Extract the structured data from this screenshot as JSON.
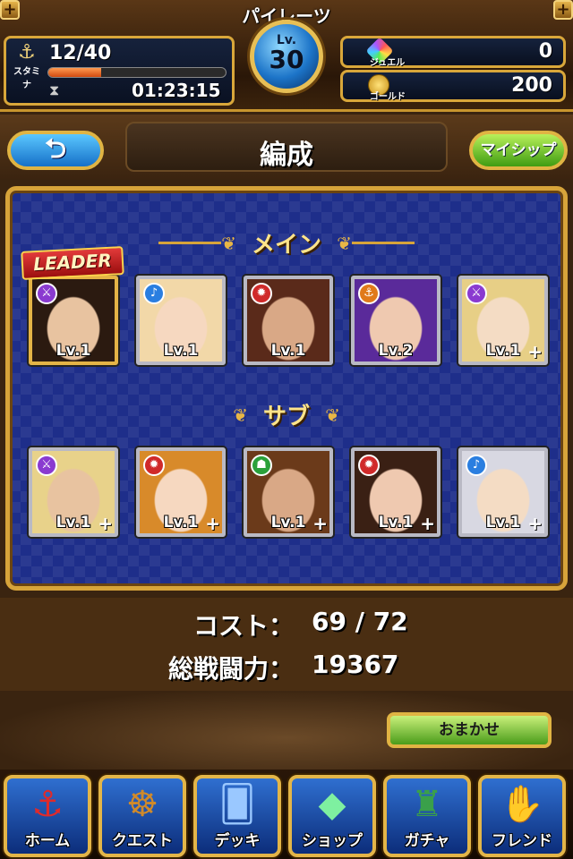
{
  "header": {
    "title": "パイレーツ",
    "stamina": {
      "label": "スタミナ",
      "value": "12/40",
      "fraction": 0.3,
      "timer": "01:23:15"
    },
    "level": {
      "prefix": "Lv.",
      "value": "30"
    },
    "jewel": {
      "label": "ジュエル",
      "value": "0"
    },
    "gold": {
      "label": "ゴールド",
      "value": "200"
    }
  },
  "titlebar": {
    "title": "編成",
    "back_label": "⮌",
    "myship_label": "マイシップ"
  },
  "main": {
    "section_main": "メイン",
    "section_sub": "サブ",
    "leader_label": "LEADER",
    "main_cards": [
      {
        "lv": "Lv.1",
        "attr": "sword",
        "attr_color": "#8a3ad0",
        "plus": ""
      },
      {
        "lv": "Lv.1",
        "attr": "note",
        "attr_color": "#2a7ee0",
        "plus": ""
      },
      {
        "lv": "Lv.1",
        "attr": "cannon",
        "attr_color": "#d02a2a",
        "plus": ""
      },
      {
        "lv": "Lv.2",
        "attr": "anchor",
        "attr_color": "#e07a1a",
        "plus": ""
      },
      {
        "lv": "Lv.1",
        "attr": "sword",
        "attr_color": "#8a3ad0",
        "plus": "+"
      }
    ],
    "sub_cards": [
      {
        "lv": "Lv.1",
        "attr": "sword",
        "attr_color": "#8a3ad0",
        "plus": "+"
      },
      {
        "lv": "Lv.1",
        "attr": "cannon",
        "attr_color": "#d02a2a",
        "plus": "+"
      },
      {
        "lv": "Lv.1",
        "attr": "hat",
        "attr_color": "#2aa03a",
        "plus": "+"
      },
      {
        "lv": "Lv.1",
        "attr": "cannon",
        "attr_color": "#d02a2a",
        "plus": "+"
      },
      {
        "lv": "Lv.1",
        "attr": "note",
        "attr_color": "#2a7ee0",
        "plus": "+"
      }
    ]
  },
  "stats": {
    "cost_label": "コスト：",
    "cost_value": "69 / 72",
    "power_label": "総戦闘力：",
    "power_value": "19367"
  },
  "omakase_label": "おまかせ",
  "nav": [
    {
      "label": "ホーム",
      "icon": "anchor-icon"
    },
    {
      "label": "クエスト",
      "icon": "ship-wheel-icon"
    },
    {
      "label": "デッキ",
      "icon": "cards-icon"
    },
    {
      "label": "ショップ",
      "icon": "gem-icon"
    },
    {
      "label": "ガチャ",
      "icon": "gacha-machine-icon"
    },
    {
      "label": "フレンド",
      "icon": "handshake-icon"
    }
  ],
  "colors": {
    "gold_frame": "#d7a43a",
    "panel_blue": "#1e2e8a",
    "accent_green": "#4b9c1a"
  }
}
